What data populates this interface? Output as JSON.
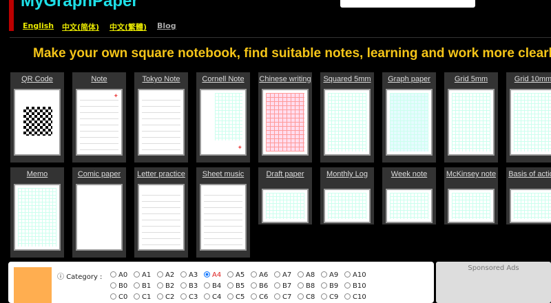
{
  "header": {
    "title": "MyGraphPaper",
    "search_placeholder": ""
  },
  "nav": [
    {
      "label": "English",
      "color": "#e8e800"
    },
    {
      "label": "中文(简体)",
      "color": "#e8e800"
    },
    {
      "label": "中文(繁體)",
      "color": "#e8e800"
    },
    {
      "label": "Blog",
      "color": "#aaaaaa"
    }
  ],
  "headline": "Make your own square notebook, find suitable notes, learning and work more clearly !",
  "templates_row1": [
    {
      "label": "QR Code",
      "preview": "qr"
    },
    {
      "label": "Note",
      "preview": "lines-leaf"
    },
    {
      "label": "Tokyo Note",
      "preview": "lines"
    },
    {
      "label": "Cornell Note",
      "preview": "cornell"
    },
    {
      "label": "Chinese writing",
      "preview": "red-grid"
    },
    {
      "label": "Squared 5mm",
      "preview": "grid"
    },
    {
      "label": "Graph paper",
      "preview": "blue-grid"
    },
    {
      "label": "Grid 5mm",
      "preview": "grid"
    },
    {
      "label": "Grid 10mm",
      "preview": "grid"
    }
  ],
  "templates_row2": [
    {
      "label": "Memo",
      "preview": "grid"
    },
    {
      "label": "Comic paper",
      "preview": "blank"
    },
    {
      "label": "Letter practice",
      "preview": "lines"
    },
    {
      "label": "Sheet music",
      "preview": "lines"
    },
    {
      "label": "Draft paper",
      "preview": "landscape"
    },
    {
      "label": "Monthly Log",
      "preview": "landscape"
    },
    {
      "label": "Week note",
      "preview": "landscape"
    },
    {
      "label": "McKinsey note",
      "preview": "landscape"
    },
    {
      "label": "Basis of action",
      "preview": "landscape"
    }
  ],
  "options": {
    "category_label": "Category :",
    "selected": "A4",
    "sizes": [
      [
        "A0",
        "A1",
        "A2",
        "A3",
        "A4",
        "A5",
        "A6",
        "A7",
        "A8",
        "A9",
        "A10"
      ],
      [
        "B0",
        "B1",
        "B2",
        "B3",
        "B4",
        "B5",
        "B6",
        "B7",
        "B8",
        "B9",
        "B10"
      ],
      [
        "C0",
        "C1",
        "C2",
        "C3",
        "C4",
        "C5",
        "C6",
        "C7",
        "C8",
        "C9",
        "C10"
      ]
    ],
    "swatch_color": "#ffae50"
  },
  "ads": {
    "label": "Sponsored Ads"
  }
}
